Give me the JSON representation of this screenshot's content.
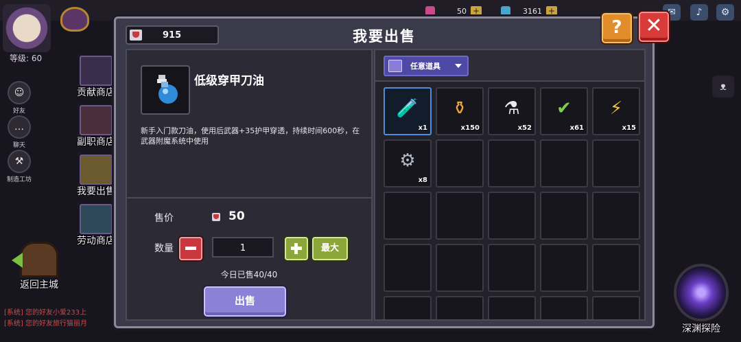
{
  "player": {
    "level_label": "等级: 60"
  },
  "resources": [
    {
      "value": "50",
      "color": "#c94a8a"
    },
    {
      "value": "3161",
      "color": "#4aa6c9"
    }
  ],
  "side_buttons": [
    "好友",
    "聊天",
    "制造工坊"
  ],
  "shop_nav": [
    {
      "label": "贡献商店"
    },
    {
      "label": "副职商店"
    },
    {
      "label": "我要出售"
    },
    {
      "label": "劳动商店"
    }
  ],
  "return_home": "返回主城",
  "chat_lines": [
    "[系统] 您的好友小爱233上",
    "[系统] 您的好友旅行猫丽月"
  ],
  "abyss_label": "深渊探险",
  "dialog": {
    "title": "我要出售",
    "coins": "915",
    "help_icon": "?",
    "close_icon": "✕"
  },
  "item": {
    "name": "低级穿甲刀油",
    "description": "新手入门款刀油，使用后武器+35护甲穿透，持续时间600秒，在武器附魔系统中使用"
  },
  "sell": {
    "price_label": "售价",
    "price_value": "50",
    "quantity_label": "数量",
    "quantity_value": "1",
    "max_label": "最大",
    "sold_today": "今日已售40/40",
    "sell_button": "出售"
  },
  "filter": {
    "label": "任意道具"
  },
  "inventory": [
    {
      "icon": "blue-potion-icon",
      "glyph": "🧪",
      "count": "x1",
      "selected": true
    },
    {
      "icon": "orange-potion-icon",
      "glyph": "⚱",
      "count": "x150",
      "selected": false
    },
    {
      "icon": "white-potion-icon",
      "glyph": "⚗",
      "count": "x52",
      "selected": false
    },
    {
      "icon": "checked-item-icon",
      "glyph": "✔",
      "count": "x61",
      "selected": false
    },
    {
      "icon": "lightning-scroll-icon",
      "glyph": "⚡",
      "count": "x15",
      "selected": false
    },
    {
      "icon": "metal-scrap-icon",
      "glyph": "⚙",
      "count": "x8",
      "selected": false
    }
  ],
  "empty_slot_count": 19
}
